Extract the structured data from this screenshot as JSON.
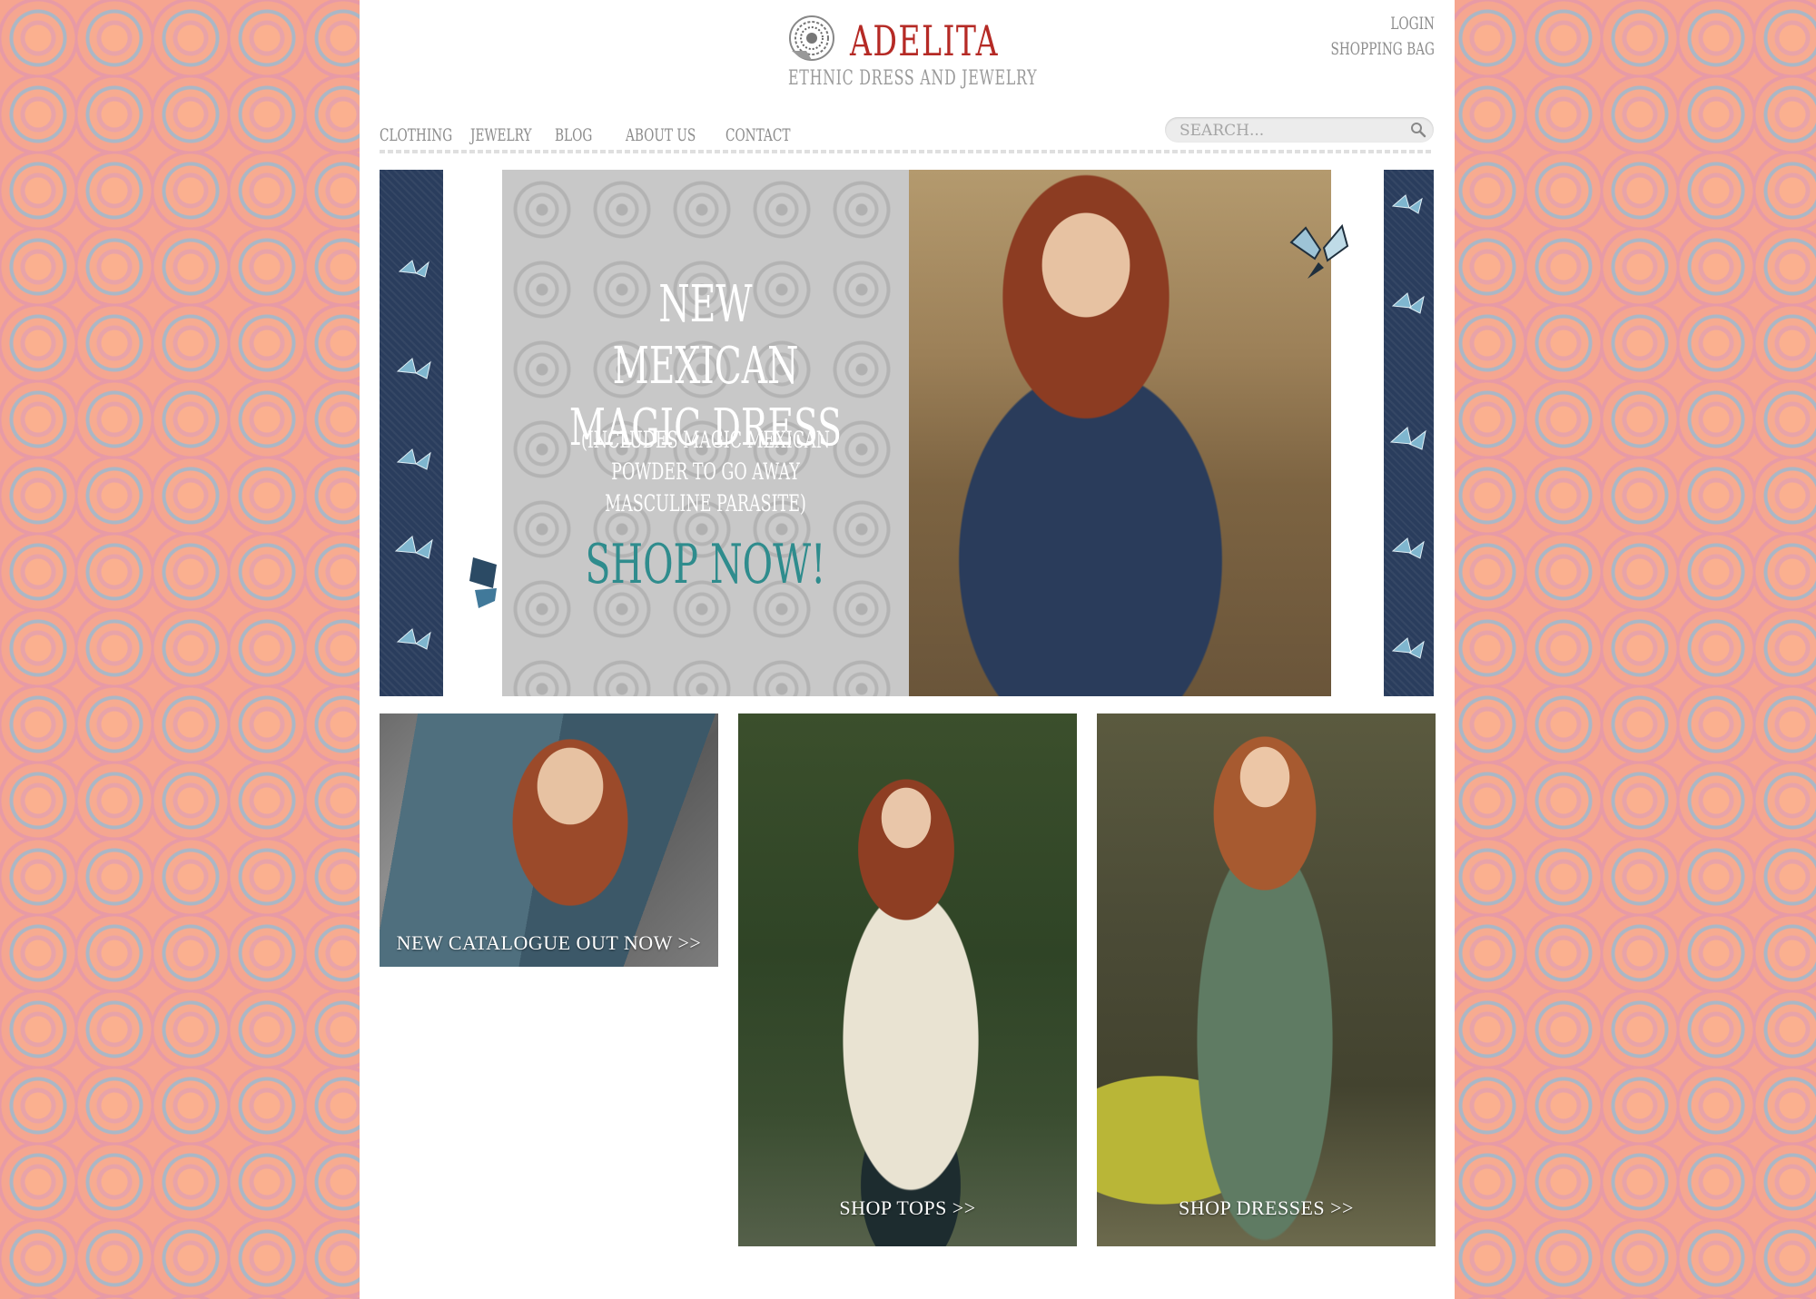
{
  "brand": {
    "name": "ADELITA",
    "tagline": "ETHNIC DRESS AND JEWELRY"
  },
  "account": {
    "login": "LOGIN",
    "shopping_bag": "SHOPPING BAG"
  },
  "nav": {
    "items": [
      {
        "label": "CLOTHING"
      },
      {
        "label": "JEWELRY"
      },
      {
        "label": "BLOG"
      },
      {
        "label": "ABOUT US"
      },
      {
        "label": "CONTACT"
      }
    ]
  },
  "search": {
    "placeholder": "SEARCH..."
  },
  "hero": {
    "title_line1": "NEW MEXICAN",
    "title_line2": "MAGIC DRESS",
    "subtitle": "(INCLUDES MAGIC MEXICAN POWDER TO GO AWAY MASCULINE PARASITE)",
    "cta": "SHOP NOW!"
  },
  "tiles": [
    {
      "label": "NEW CATALOGUE OUT NOW >>"
    },
    {
      "label": "SHOP TOPS >>"
    },
    {
      "label": "SHOP DRESSES >>"
    }
  ],
  "colors": {
    "brand_red": "#b52a25",
    "nav_gray": "#8c8c8c",
    "cta_teal": "#2f8c8d",
    "background_coral": "#f3a48e"
  }
}
